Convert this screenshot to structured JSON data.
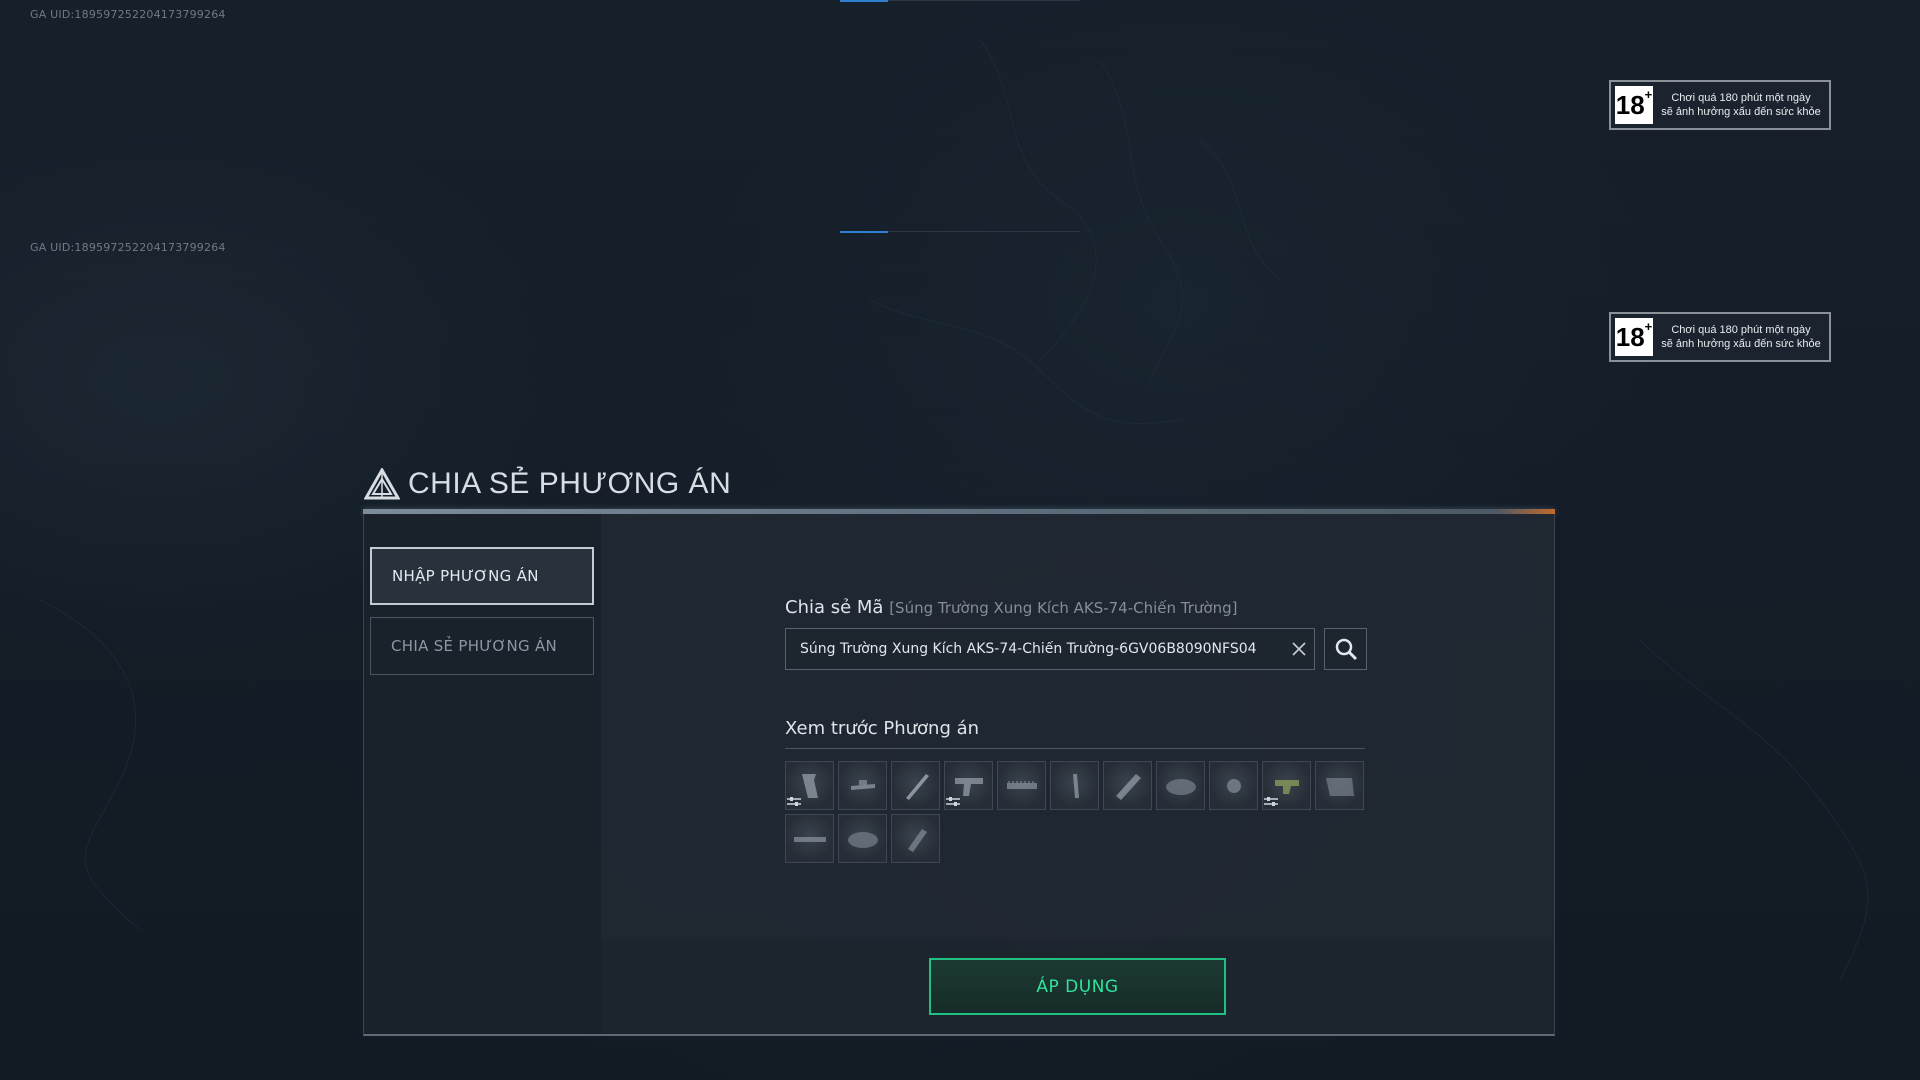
{
  "overlay": {
    "uid_text": "GA UID:18959725220417379926​4",
    "age_badge": {
      "rating": "18",
      "rating_sup": "+",
      "line1": "Chơi quá 180 phút một ngày",
      "line2": "sẽ ảnh hưởng xấu đến sức khỏe"
    }
  },
  "dialog": {
    "title": "CHIA SẺ PHƯƠNG ÁN",
    "title_icon": "triangle-logo-icon",
    "sidebar": {
      "items": [
        {
          "label": "NHẬP PHƯƠNG ÁN",
          "active": true
        },
        {
          "label": "CHIA SẺ PHƯƠNG ÁN",
          "active": false
        }
      ]
    },
    "share_code": {
      "label": "Chia sẻ Mã",
      "weapon_note": "[Súng Trường Xung Kích AKS-74-Chiến Trường]",
      "input_value": "Súng Trường Xung Kích AKS-74-Chiến Trường-6GV06B8090NFS04",
      "clear_icon": "close-icon",
      "search_icon": "search-icon"
    },
    "preview": {
      "label": "Xem trước Phương án",
      "slots": [
        {
          "icon": "grip-icon",
          "has_mod": true
        },
        {
          "icon": "sight-mount-icon",
          "has_mod": false
        },
        {
          "icon": "barrel-icon",
          "has_mod": false
        },
        {
          "icon": "receiver-icon",
          "has_mod": true
        },
        {
          "icon": "rail-icon",
          "has_mod": false
        },
        {
          "icon": "pin-icon",
          "has_mod": false
        },
        {
          "icon": "handguard-icon",
          "has_mod": false
        },
        {
          "icon": "pad-icon",
          "has_mod": false
        },
        {
          "icon": "knob-icon",
          "has_mod": false
        },
        {
          "icon": "scope-icon",
          "has_mod": true
        },
        {
          "icon": "stock-icon",
          "has_mod": false
        },
        {
          "icon": "rail-long-icon",
          "has_mod": false
        },
        {
          "icon": "pad-icon",
          "has_mod": false
        },
        {
          "icon": "suppressor-icon",
          "has_mod": false
        }
      ]
    },
    "apply_label": "ÁP DỤNG"
  },
  "colors": {
    "background": "#141c26",
    "accent_green": "#22c080",
    "accent_blue": "#2f7fd0",
    "accent_orange": "#c06a2a"
  }
}
